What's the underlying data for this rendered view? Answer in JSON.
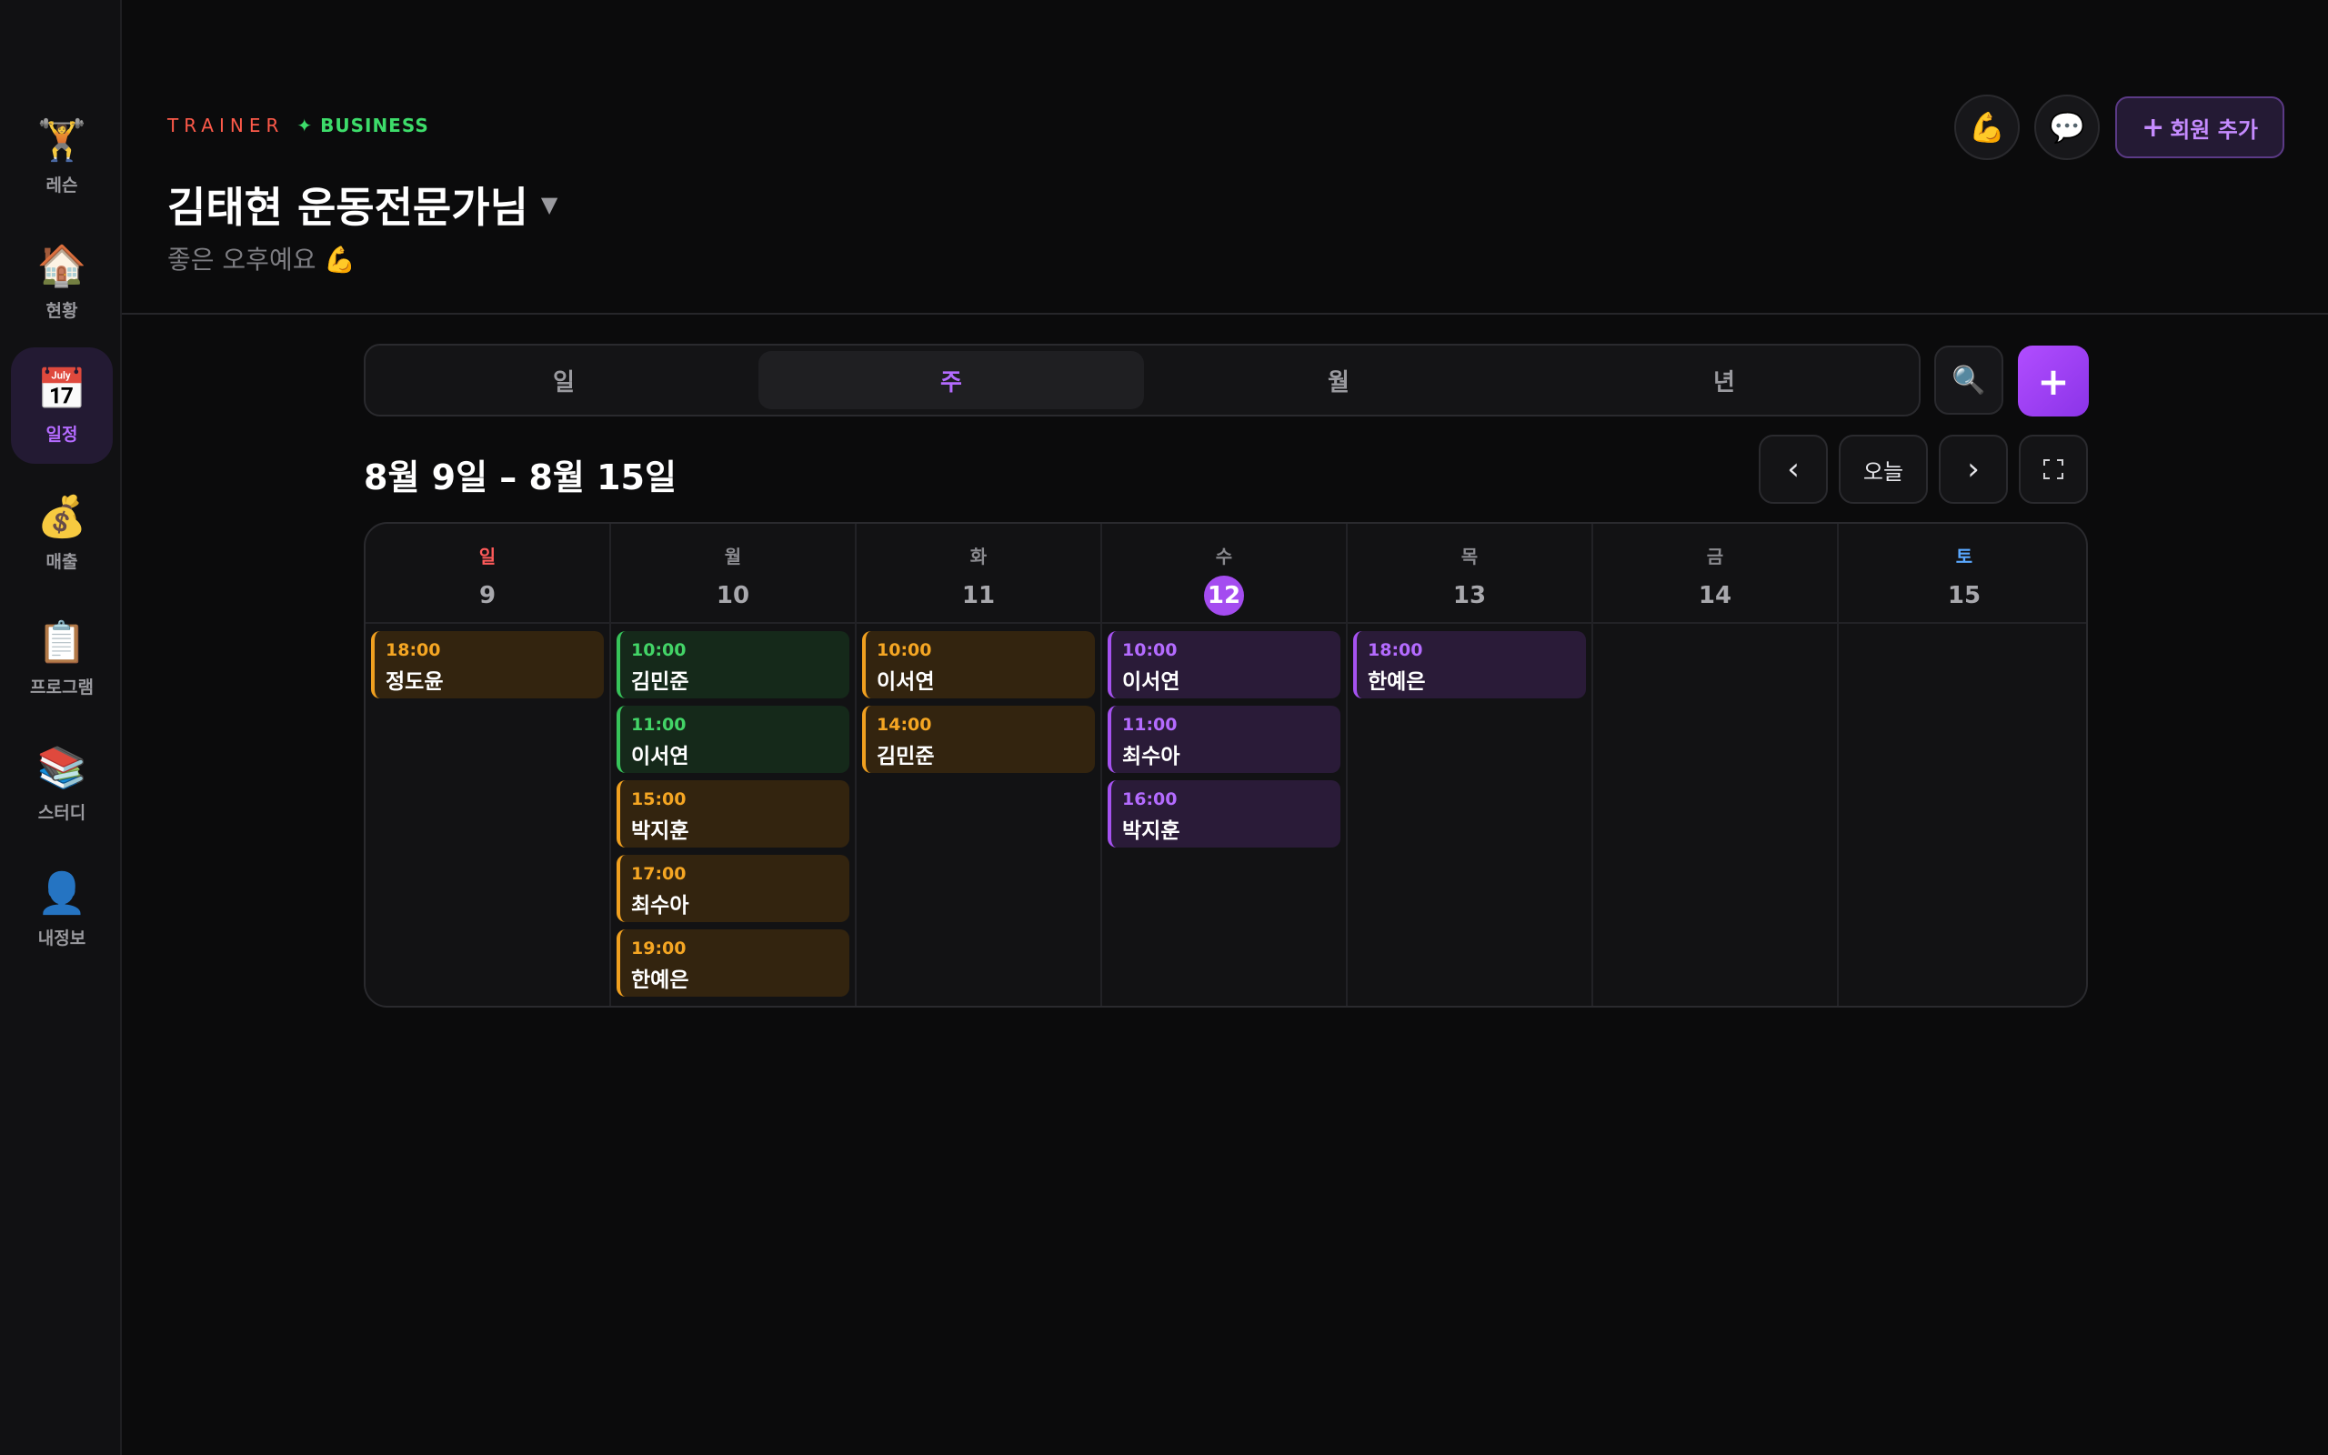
{
  "sidebar": {
    "items": [
      {
        "icon": "🏋️",
        "label": "레슨"
      },
      {
        "icon": "🏠",
        "label": "현황"
      },
      {
        "icon": "📅",
        "label": "일정"
      },
      {
        "icon": "💰",
        "label": "매출"
      },
      {
        "icon": "📋",
        "label": "프로그램"
      },
      {
        "icon": "📚",
        "label": "스터디"
      },
      {
        "icon": "👤",
        "label": "내정보"
      }
    ],
    "active_index": 2
  },
  "header": {
    "brand_trainer": "TRAINER",
    "brand_business": "✦ BUSINESS",
    "title": "김태현 운동전문가님",
    "title_caret": "▼",
    "greeting": "좋은 오후예요 💪",
    "muscle_icon": "💪",
    "chat_icon": "💬",
    "add_member_plus": "+",
    "add_member_label": "회원 추가"
  },
  "view_switch": {
    "tabs": [
      "일",
      "주",
      "월",
      "년"
    ],
    "active_index": 1,
    "search_icon": "🔍",
    "add_label": "+"
  },
  "range": {
    "label": "8월 9일 – 8월 15일",
    "prev": "‹",
    "today": "오늘",
    "next": "›"
  },
  "calendar": {
    "days": [
      {
        "weekday": "일",
        "date": "9",
        "events": [
          {
            "time": "18:00",
            "name": "정도윤",
            "color": "orange"
          }
        ]
      },
      {
        "weekday": "월",
        "date": "10",
        "events": [
          {
            "time": "10:00",
            "name": "김민준",
            "color": "green"
          },
          {
            "time": "11:00",
            "name": "이서연",
            "color": "green"
          },
          {
            "time": "15:00",
            "name": "박지훈",
            "color": "orange"
          },
          {
            "time": "17:00",
            "name": "최수아",
            "color": "orange"
          },
          {
            "time": "19:00",
            "name": "한예은",
            "color": "orange"
          }
        ]
      },
      {
        "weekday": "화",
        "date": "11",
        "events": [
          {
            "time": "10:00",
            "name": "이서연",
            "color": "orange"
          },
          {
            "time": "14:00",
            "name": "김민준",
            "color": "orange"
          }
        ]
      },
      {
        "weekday": "수",
        "date": "12",
        "today": true,
        "events": [
          {
            "time": "10:00",
            "name": "이서연",
            "color": "purple"
          },
          {
            "time": "11:00",
            "name": "최수아",
            "color": "purple"
          },
          {
            "time": "16:00",
            "name": "박지훈",
            "color": "purple"
          }
        ]
      },
      {
        "weekday": "목",
        "date": "13",
        "events": [
          {
            "time": "18:00",
            "name": "한예은",
            "color": "purple"
          }
        ]
      },
      {
        "weekday": "금",
        "date": "14",
        "events": []
      },
      {
        "weekday": "토",
        "date": "15",
        "events": []
      }
    ]
  },
  "colors": {
    "accent": "#a44cf0",
    "orange": "#f5a623",
    "green": "#43d467",
    "sunday": "#ff5a5a",
    "saturday": "#5aa8ff"
  }
}
